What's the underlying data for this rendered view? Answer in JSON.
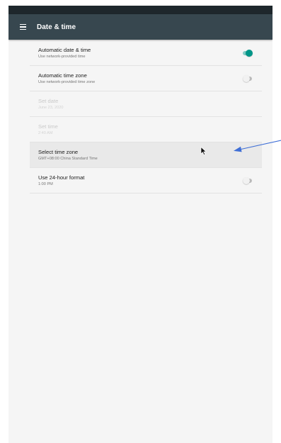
{
  "app": {
    "title": "Date & time"
  },
  "settings": [
    {
      "title": "Automatic date & time",
      "summary": "Use network-provided time",
      "toggle": "on"
    },
    {
      "title": "Automatic time zone",
      "summary": "Use network-provided time zone",
      "toggle": "off"
    },
    {
      "title": "Set date",
      "summary": "June 23, 2020",
      "disabled": true
    },
    {
      "title": "Set time",
      "summary": "2:40 AM",
      "disabled": true
    },
    {
      "title": "Select time zone",
      "summary": "GMT+08:00 China Standard Time"
    },
    {
      "title": "Use 24-hour format",
      "summary": "1:00 PM",
      "toggle": "off"
    }
  ],
  "colors": {
    "app_bar": "#37474f",
    "status_bar": "#1e272c",
    "toggle_on": "#009688",
    "annotation_arrow": "#3f6fd6"
  },
  "icons": {
    "menu": "hamburger-menu-icon",
    "cursor": "mouse-pointer-icon"
  }
}
